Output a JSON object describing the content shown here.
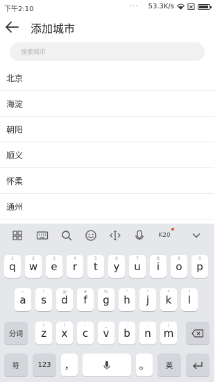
{
  "status": {
    "time": "下午2:10",
    "dots": "···",
    "speed": "53.3K/s"
  },
  "header": {
    "title": "添加城市"
  },
  "search": {
    "placeholder": "搜索城市"
  },
  "cities": [
    "北京",
    "海淀",
    "朝阳",
    "顺义",
    "怀柔",
    "通州"
  ],
  "keyboard": {
    "toolbar": {
      "k20": "K20"
    },
    "row1": [
      {
        "key": "q",
        "sub": "1"
      },
      {
        "key": "w",
        "sub": "2"
      },
      {
        "key": "e",
        "sub": "3"
      },
      {
        "key": "r",
        "sub": "4"
      },
      {
        "key": "t",
        "sub": "5"
      },
      {
        "key": "y",
        "sub": "6"
      },
      {
        "key": "u",
        "sub": "7"
      },
      {
        "key": "i",
        "sub": "8"
      },
      {
        "key": "o",
        "sub": "9"
      },
      {
        "key": "p",
        "sub": "0"
      }
    ],
    "row2": [
      {
        "key": "a",
        "sub": "~"
      },
      {
        "key": "s",
        "sub": "!"
      },
      {
        "key": "d",
        "sub": "@"
      },
      {
        "key": "f",
        "sub": "#"
      },
      {
        "key": "g",
        "sub": "%"
      },
      {
        "key": "h",
        "sub": "\""
      },
      {
        "key": "j",
        "sub": "\""
      },
      {
        "key": "k",
        "sub": "*"
      },
      {
        "key": "l",
        "sub": "?"
      }
    ],
    "row3": [
      {
        "key": "z",
        "sub": "("
      },
      {
        "key": "x",
        "sub": ")"
      },
      {
        "key": "c",
        "sub": "-"
      },
      {
        "key": "v",
        "sub": "_"
      },
      {
        "key": "b",
        "sub": ":"
      },
      {
        "key": "n",
        "sub": ";"
      },
      {
        "key": "m",
        "sub": "/"
      }
    ],
    "fenci": "分词",
    "fu": "符",
    "num": "123",
    "comma": "，",
    "period": "。",
    "lang": "英"
  }
}
